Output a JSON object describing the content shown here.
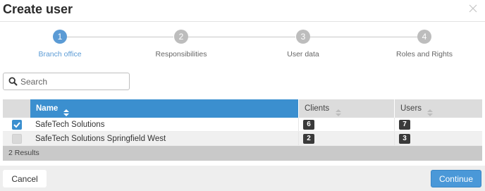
{
  "dialog": {
    "title": "Create user",
    "close_icon": "close-icon"
  },
  "stepper": {
    "steps": [
      {
        "number": "1",
        "label": "Branch office",
        "active": true
      },
      {
        "number": "2",
        "label": "Responsibilities",
        "active": false
      },
      {
        "number": "3",
        "label": "User data",
        "active": false
      },
      {
        "number": "4",
        "label": "Roles and Rights",
        "active": false
      }
    ]
  },
  "search": {
    "placeholder": "Search",
    "value": "",
    "icon": "search-icon"
  },
  "table": {
    "columns": [
      "Name",
      "Clients",
      "Users"
    ],
    "sorted_column": "Name",
    "rows": [
      {
        "checked": true,
        "name": "SafeTech Solutions",
        "clients": "6",
        "users": "7"
      },
      {
        "checked": false,
        "name": "SafeTech Solutions Springfield West",
        "clients": "2",
        "users": "3"
      }
    ],
    "footer": "2 Results"
  },
  "actions": {
    "cancel_label": "Cancel",
    "continue_label": "Continue"
  },
  "colors": {
    "accent": "#3b8fcf",
    "step_active": "#5b9bd5",
    "step_inactive": "#bdbdbd",
    "badge": "#3a3a3a"
  }
}
